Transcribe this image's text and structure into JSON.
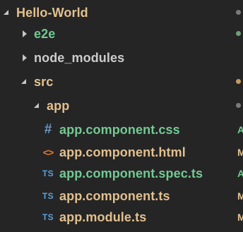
{
  "colors": {
    "modified": "#e2c08d",
    "added": "#73c991",
    "untracked": "#73c991",
    "default": "#cccccc",
    "dot_modified": "#c49a5a",
    "dot_added": "#6f9f78",
    "dot_default": "#7a7a7a"
  },
  "explorer": {
    "root": {
      "label": "Hello-World",
      "expanded": true
    },
    "items": [
      {
        "label": "e2e",
        "kind": "folder",
        "expanded": false
      },
      {
        "label": "node_modules",
        "kind": "folder",
        "expanded": false
      },
      {
        "label": "src",
        "kind": "folder",
        "expanded": true
      },
      {
        "label": "app",
        "kind": "folder",
        "expanded": true
      },
      {
        "label": "app.component.css",
        "kind": "file",
        "icon": "css-hash-icon",
        "icon_glyph": "#",
        "status": "A"
      },
      {
        "label": "app.component.html",
        "kind": "file",
        "icon": "html-angle-icon",
        "icon_glyph": "<>",
        "status": "M"
      },
      {
        "label": "app.component.spec.ts",
        "kind": "file",
        "icon": "typescript-icon",
        "icon_glyph": "TS",
        "status": "A"
      },
      {
        "label": "app.component.ts",
        "kind": "file",
        "icon": "typescript-icon",
        "icon_glyph": "TS",
        "status": "M"
      },
      {
        "label": "app.module.ts",
        "kind": "file",
        "icon": "typescript-icon",
        "icon_glyph": "TS",
        "status": "M"
      }
    ]
  }
}
